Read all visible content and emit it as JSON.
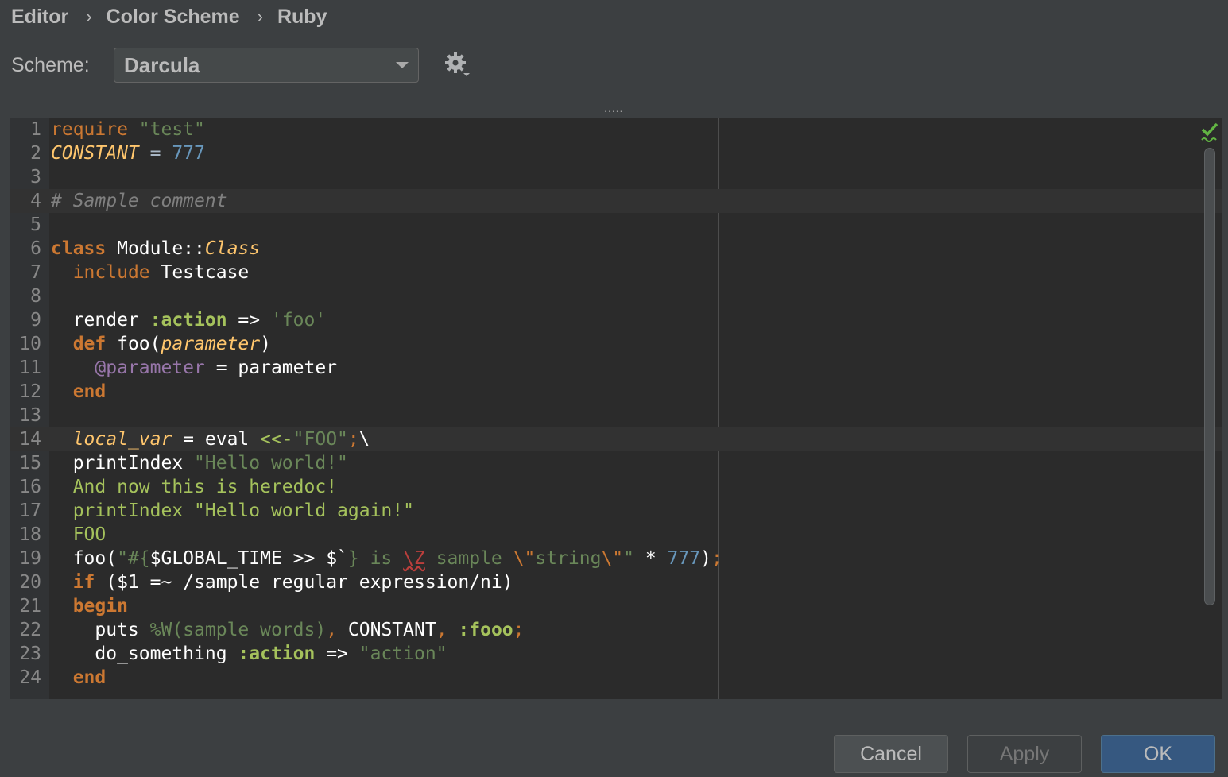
{
  "breadcrumb": {
    "items": [
      "Editor",
      "Color Scheme",
      "Ruby"
    ]
  },
  "scheme": {
    "label": "Scheme:",
    "value": "Darcula"
  },
  "splitter": {
    "grip": "....."
  },
  "editor": {
    "line_numbers": [
      "1",
      "2",
      "3",
      "4",
      "5",
      "6",
      "7",
      "8",
      "9",
      "10",
      "11",
      "12",
      "13",
      "14",
      "15",
      "16",
      "17",
      "18",
      "19",
      "20",
      "21",
      "22",
      "23",
      "24"
    ],
    "lines": [
      [
        [
          "k",
          "require"
        ],
        [
          "p",
          " "
        ],
        [
          "s",
          "\"test\""
        ]
      ],
      [
        [
          "const",
          "CONSTANT"
        ],
        [
          "p",
          " = "
        ],
        [
          "n",
          "777"
        ]
      ],
      [],
      [
        [
          "c",
          "# Sample comment"
        ]
      ],
      [],
      [
        [
          "kb",
          "class"
        ],
        [
          "w",
          " Module::"
        ],
        [
          "cls",
          "Class"
        ]
      ],
      [
        [
          "p",
          "  "
        ],
        [
          "k",
          "include"
        ],
        [
          "w",
          " Testcase"
        ]
      ],
      [],
      [
        [
          "p",
          "  "
        ],
        [
          "w",
          "render "
        ],
        [
          "sym",
          ":action"
        ],
        [
          "w",
          " => "
        ],
        [
          "s",
          "'foo'"
        ]
      ],
      [
        [
          "p",
          "  "
        ],
        [
          "kb",
          "def"
        ],
        [
          "w",
          " foo("
        ],
        [
          "par",
          "parameter"
        ],
        [
          "w",
          ")"
        ]
      ],
      [
        [
          "p",
          "    "
        ],
        [
          "ivar",
          "@parameter"
        ],
        [
          "w",
          " = parameter"
        ]
      ],
      [
        [
          "p",
          "  "
        ],
        [
          "kb",
          "end"
        ]
      ],
      [],
      [
        [
          "p",
          "  "
        ],
        [
          "lv",
          "local_var"
        ],
        [
          "w",
          " = eval "
        ],
        [
          "hd",
          "<<-"
        ],
        [
          "s",
          "\"FOO\""
        ],
        [
          "k",
          ";"
        ],
        [
          "w",
          "\\"
        ]
      ],
      [
        [
          "p",
          "  "
        ],
        [
          "w",
          "printIndex "
        ],
        [
          "s",
          "\"Hello world!\""
        ]
      ],
      [
        [
          "p",
          "  "
        ],
        [
          "hd",
          "And now this is heredoc!"
        ]
      ],
      [
        [
          "p",
          "  "
        ],
        [
          "hd",
          "printIndex \"Hello world again!\""
        ]
      ],
      [
        [
          "p",
          "  "
        ],
        [
          "hd",
          "FOO"
        ]
      ],
      [
        [
          "p",
          "  "
        ],
        [
          "w",
          "foo("
        ],
        [
          "s",
          "\"#{"
        ],
        [
          "w",
          "$GLOBAL_TIME >> $`"
        ],
        [
          "s",
          "} is "
        ],
        [
          "sq",
          "\\Z"
        ],
        [
          "s",
          " sample "
        ],
        [
          "esc",
          "\\\""
        ],
        [
          "s",
          "string"
        ],
        [
          "esc",
          "\\\""
        ],
        [
          "s",
          "\""
        ],
        [
          "w",
          " * "
        ],
        [
          "n",
          "777"
        ],
        [
          "w",
          ")"
        ],
        [
          "k",
          ";"
        ]
      ],
      [
        [
          "p",
          "  "
        ],
        [
          "kb",
          "if"
        ],
        [
          "w",
          " ($1 =~ "
        ],
        [
          "w",
          "/sample regular expression/ni)"
        ]
      ],
      [
        [
          "p",
          "  "
        ],
        [
          "kb",
          "begin"
        ]
      ],
      [
        [
          "p",
          "    "
        ],
        [
          "w",
          "puts "
        ],
        [
          "s",
          "%W(sample words)"
        ],
        [
          "k",
          ","
        ],
        [
          "w",
          " CONSTANT"
        ],
        [
          "k",
          ","
        ],
        [
          "w",
          " "
        ],
        [
          "sym",
          ":fooo"
        ],
        [
          "k",
          ";"
        ]
      ],
      [
        [
          "p",
          "    "
        ],
        [
          "w",
          "do_something "
        ],
        [
          "sym",
          ":action"
        ],
        [
          "w",
          " => "
        ],
        [
          "s",
          "\"action\""
        ]
      ],
      [
        [
          "p",
          "  "
        ],
        [
          "kb",
          "end"
        ]
      ]
    ],
    "highlighted_lines": [
      4,
      14
    ]
  },
  "buttons": {
    "cancel": "Cancel",
    "apply": "Apply",
    "ok": "OK"
  },
  "colors": {
    "background": "#3c3f41",
    "editor_background": "#2b2b2b",
    "keyword": "#cc7832",
    "string": "#6a8759",
    "number": "#6897bb",
    "comment": "#808080",
    "ok_button": "#365880"
  },
  "icons": {
    "settings": "gear-icon",
    "inspection": "check-icon",
    "dropdown": "chevron-down-icon"
  }
}
